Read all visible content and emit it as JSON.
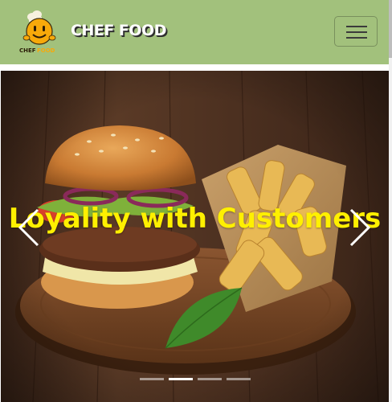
{
  "brand": {
    "name": "CHEF FOOD",
    "logo_text": "CHEF FOOD",
    "logo_icon": "chef-face-icon"
  },
  "navbar": {
    "background": "#a2c17c",
    "toggler_icon": "hamburger-menu-icon"
  },
  "carousel": {
    "caption": "Loyality with Customers",
    "caption_color": "#fff000",
    "slide_image": "burger-and-fries-photo",
    "prev_icon": "chevron-left-icon",
    "next_icon": "chevron-right-icon",
    "indicator_count": 4,
    "active_index": 1
  }
}
